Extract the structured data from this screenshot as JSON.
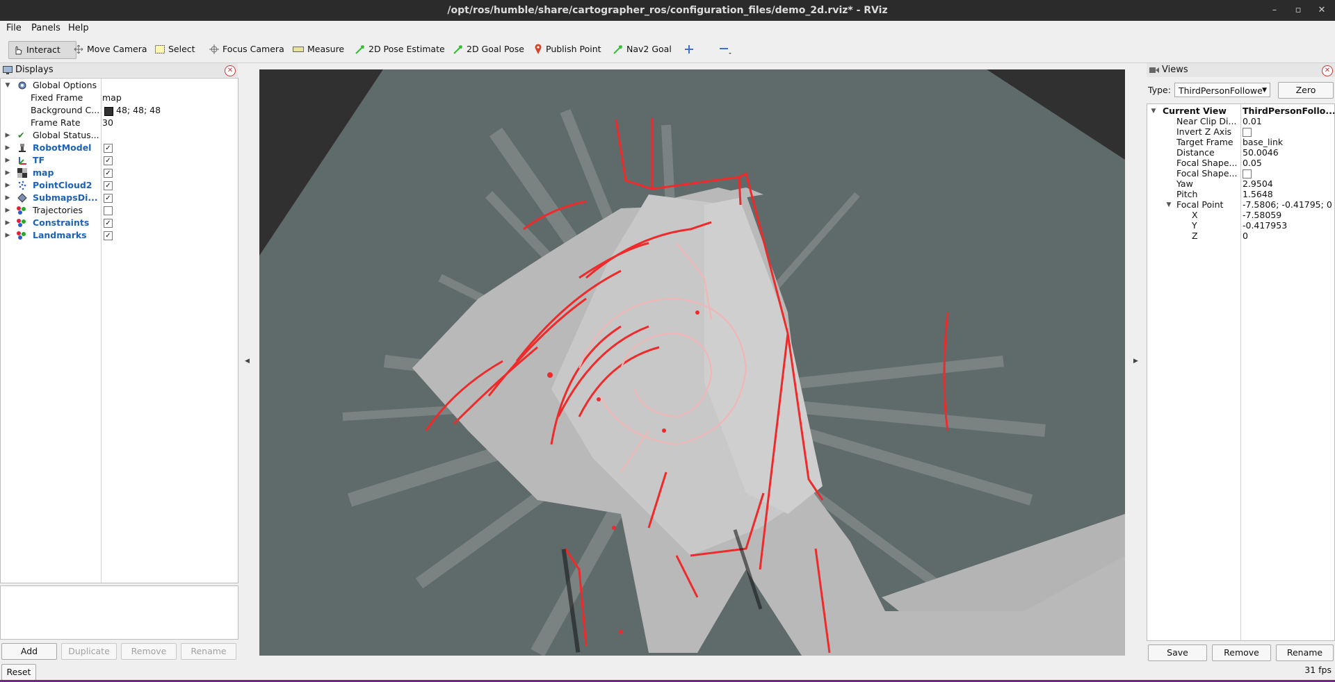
{
  "window": {
    "title": "/opt/ros/humble/share/cartographer_ros/configuration_files/demo_2d.rviz* - RViz"
  },
  "menu": {
    "file": "File",
    "panels": "Panels",
    "help": "Help"
  },
  "toolbar": {
    "interact": "Interact",
    "move_camera": "Move Camera",
    "select": "Select",
    "focus_camera": "Focus Camera",
    "measure": "Measure",
    "pose_estimate": "2D Pose Estimate",
    "goal_pose": "2D Goal Pose",
    "publish_point": "Publish Point",
    "nav2_goal": "Nav2 Goal"
  },
  "displays": {
    "title": "Displays",
    "global_options": {
      "label": "Global Options",
      "fixed_frame_label": "Fixed Frame",
      "fixed_frame_value": "map",
      "background_label": "Background C...",
      "background_value": "48; 48; 48",
      "frame_rate_label": "Frame Rate",
      "frame_rate_value": "30"
    },
    "global_status": "Global Status...",
    "items": [
      {
        "label": "RobotModel",
        "checked": true
      },
      {
        "label": "TF",
        "checked": true
      },
      {
        "label": "map",
        "checked": true
      },
      {
        "label": "PointCloud2",
        "checked": true
      },
      {
        "label": "SubmapsDi...",
        "checked": true
      },
      {
        "label": "Trajectories",
        "checked": false
      },
      {
        "label": "Constraints",
        "checked": true
      },
      {
        "label": "Landmarks",
        "checked": true
      }
    ],
    "buttons": {
      "add": "Add",
      "duplicate": "Duplicate",
      "remove": "Remove",
      "rename": "Rename"
    }
  },
  "reset": "Reset",
  "views": {
    "title": "Views",
    "type_label": "Type:",
    "type_value": "ThirdPersonFollowe",
    "zero": "Zero",
    "current_view": "Current View",
    "current_view_type": "ThirdPersonFollo...",
    "props": [
      {
        "label": "Near Clip Di...",
        "value": "0.01"
      },
      {
        "label": "Invert Z Axis",
        "value": ""
      },
      {
        "label": "Target Frame",
        "value": "base_link"
      },
      {
        "label": "Distance",
        "value": "50.0046"
      },
      {
        "label": "Focal Shape...",
        "value": "0.05"
      },
      {
        "label": "Focal Shape...",
        "value": ""
      },
      {
        "label": "Yaw",
        "value": "2.9504"
      },
      {
        "label": "Pitch",
        "value": "1.5648"
      }
    ],
    "focal_point": {
      "label": "Focal Point",
      "value": "-7.5806; -0.41795; 0",
      "x_label": "X",
      "x": "-7.58059",
      "y_label": "Y",
      "y": "-0.417953",
      "z_label": "Z",
      "z": "0"
    },
    "buttons": {
      "save": "Save",
      "remove": "Remove",
      "rename": "Rename"
    }
  },
  "status": {
    "fps": "31 fps"
  },
  "colors": {
    "background": "#303030",
    "map_free": "#c2c2c2",
    "map_unknown": "#5f6b6a",
    "scan": "#ef2a2a"
  }
}
